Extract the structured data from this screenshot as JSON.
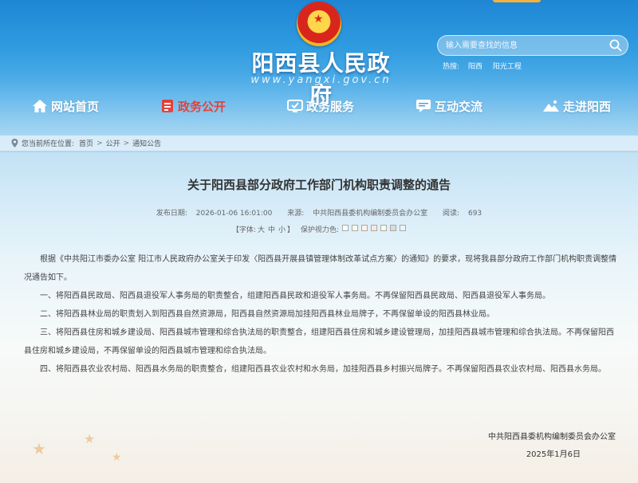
{
  "site": {
    "title": "阳西县人民政府",
    "url": "www.yangxi.gov.cn"
  },
  "search": {
    "placeholder": "输入需要查找的信息",
    "hot_label": "热搜:",
    "hot_links": [
      "阳西",
      "阳光工程"
    ]
  },
  "nav": {
    "items": [
      {
        "label": "网站首页",
        "icon": "home-icon"
      },
      {
        "label": "政务公开",
        "icon": "document-icon"
      },
      {
        "label": "政务服务",
        "icon": "service-icon"
      },
      {
        "label": "互动交流",
        "icon": "chat-icon"
      },
      {
        "label": "走进阳西",
        "icon": "landscape-icon"
      }
    ],
    "active_color": "#e02a22"
  },
  "breadcrumb": {
    "prefix": "您当前所在位置:",
    "items": [
      "首页",
      "公开",
      "通知公告"
    ],
    "separator": ">"
  },
  "article": {
    "title": "关于阳西县部分政府工作部门机构职责调整的通告",
    "meta": {
      "date_label": "发布日期:",
      "date": "2026-01-06 16:01:00",
      "source_label": "来源:",
      "source": "中共阳西县委机构编制委员会办公室",
      "views_label": "阅读:",
      "views": "693"
    },
    "tools": {
      "font_label": "【字体:",
      "font_large": "大",
      "font_medium": "中",
      "font_small": "小",
      "font_end": "】",
      "eye_label": "保护视力色:"
    },
    "eye_colors": [
      "#ffffff",
      "#fafbe6",
      "#fff2e2",
      "#fde6e0",
      "#f3ffe1",
      "#dadadb",
      "#e8f3fb"
    ],
    "paragraphs": [
      "根据《中共阳江市委办公室 阳江市人民政府办公室关于印发〈阳西县开展县镇管理体制改革试点方案〉的通知》的要求，现将我县部分政府工作部门机构职责调整情况通告如下。",
      "一、将阳西县民政局、阳西县退役军人事务局的职责整合，组建阳西县民政和退役军人事务局。不再保留阳西县民政局、阳西县退役军人事务局。",
      "二、将阳西县林业局的职责划入到阳西县自然资源局，阳西县自然资源局加挂阳西县林业局牌子，不再保留单设的阳西县林业局。",
      "三、将阳西县住房和城乡建设局、阳西县城市管理和综合执法局的职责整合，组建阳西县住房和城乡建设管理局，加挂阳西县城市管理和综合执法局。不再保留阳西县住房和城乡建设局，不再保留单设的阳西县城市管理和综合执法局。",
      "四、将阳西县农业农村局、阳西县水务局的职责整合，组建阳西县农业农村和水务局，加挂阳西县乡村振兴局牌子。不再保留阳西县农业农村局、阳西县水务局。"
    ],
    "signature": "中共阳西县委机构编制委员会办公室",
    "sign_date": "2025年1月6日"
  }
}
